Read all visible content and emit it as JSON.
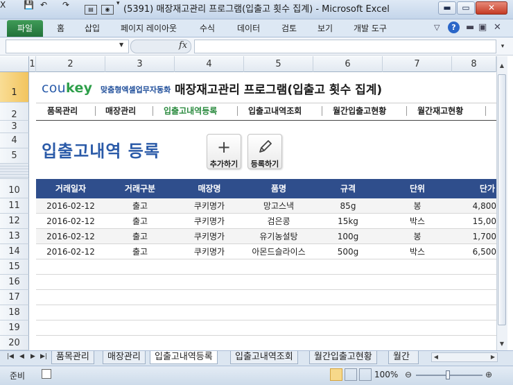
{
  "window": {
    "title": "(5391) 매장재고관리 프로그램(입출고 횟수 집계) - Microsoft Excel",
    "app_icon": "excel-icon",
    "quick_access": [
      "save-icon",
      "undo-icon",
      "redo-icon",
      "form-icon",
      "camera-icon"
    ]
  },
  "ribbon": {
    "file_tab": "파일",
    "tabs": [
      "홈",
      "삽입",
      "페이지 레이아웃",
      "수식",
      "데이터",
      "검토",
      "보기",
      "개발 도구"
    ]
  },
  "formula_bar": {
    "name_box": "",
    "fx_label": "fx",
    "value": ""
  },
  "columns": [
    "1",
    "2",
    "3",
    "4",
    "5",
    "6",
    "7",
    "8"
  ],
  "rows": [
    "1",
    "2",
    "3",
    "4",
    "5",
    "",
    "10",
    "11",
    "12",
    "13",
    "14",
    "15",
    "16",
    "17",
    "18",
    "19",
    "20"
  ],
  "sheet": {
    "brand": {
      "co": "cou",
      "key": "key",
      "tagline": "맞춤형엑셀업무자동화"
    },
    "app_title": "매장재고관리 프로그램(입출고 횟수 집계)",
    "nav": [
      "품목관리",
      "매장관리",
      "입출고내역등록",
      "입출고내역조회",
      "월간입출고현황",
      "월간재고현황"
    ],
    "nav_active": 2,
    "page_heading": "입출고내역 등록",
    "buttons": {
      "add": {
        "icon": "plus-icon",
        "label": "추가하기"
      },
      "register": {
        "icon": "pencil-icon",
        "label": "등록하기"
      }
    },
    "table": {
      "headers": [
        "거래일자",
        "거래구분",
        "매장명",
        "품명",
        "규격",
        "단위",
        "단가"
      ],
      "rows": [
        [
          "2016-02-12",
          "출고",
          "쿠키명가",
          "망고스낵",
          "85g",
          "봉",
          "4,800"
        ],
        [
          "2016-02-12",
          "출고",
          "쿠키명가",
          "검은콩",
          "15kg",
          "박스",
          "15,00"
        ],
        [
          "2016-02-12",
          "출고",
          "쿠키명가",
          "유기농설탕",
          "100g",
          "봉",
          "1,700"
        ],
        [
          "2016-02-12",
          "출고",
          "쿠키명가",
          "아몬드슬라이스",
          "500g",
          "박스",
          "6,500"
        ]
      ]
    }
  },
  "sheet_tabs": [
    "품목관리",
    "매장관리",
    "입출고내역등록",
    "입출고내역조회",
    "월간입출고현황",
    "월간"
  ],
  "active_sheet": 2,
  "status": {
    "ready": "준비",
    "zoom": "100%"
  }
}
